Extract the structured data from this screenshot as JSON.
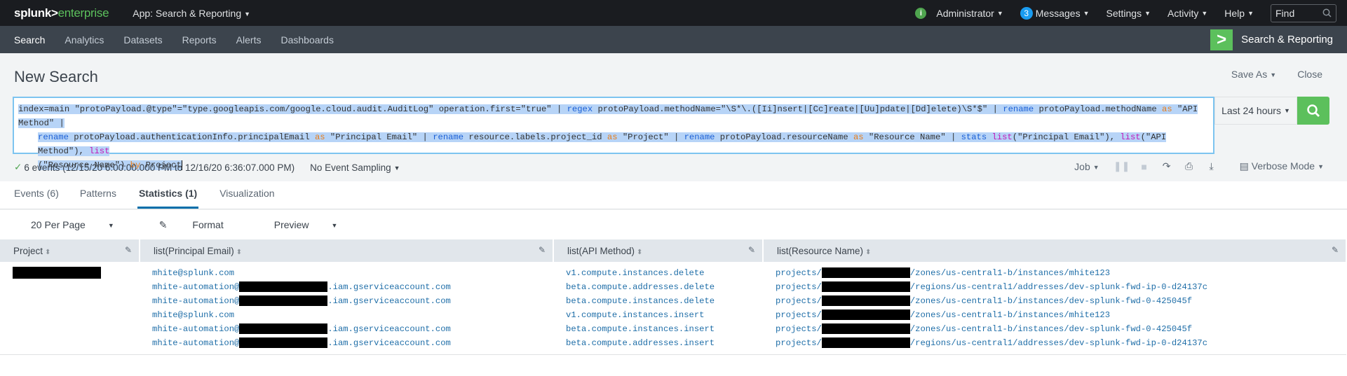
{
  "topbar": {
    "logo_primary": "splunk>",
    "logo_secondary": "enterprise",
    "app_menu": "App: Search & Reporting",
    "user_menu": "Administrator",
    "messages_count": "3",
    "messages_label": "Messages",
    "settings_label": "Settings",
    "activity_label": "Activity",
    "help_label": "Help",
    "find_placeholder": "Find"
  },
  "navbar": {
    "items": [
      "Search",
      "Analytics",
      "Datasets",
      "Reports",
      "Alerts",
      "Dashboards"
    ],
    "active": "Search",
    "app_title": "Search & Reporting"
  },
  "header": {
    "title": "New Search",
    "save_as": "Save As",
    "close": "Close"
  },
  "search": {
    "query_line1_a": "index=main \"protoPayload.@type\"=\"type.googleapis.com/google.cloud.audit.AuditLog\" operation.first=\"true\" | ",
    "kw_regex": "regex",
    "query_line1_b": " protoPayload.methodName=\"\\S*\\.([Ii]nsert|[Cc]reate|[Uu]pdate|[Dd]elete)\\S*$\" | ",
    "kw_rename1": "rename",
    "query_line1_c": " protoPayload.methodName ",
    "kw_as1": "as",
    "query_line1_d": " \"API Method\" |",
    "kw_rename2": "rename",
    "query_line2_a": " protoPayload.authenticationInfo.principalEmail ",
    "kw_as2": "as",
    "query_line2_b": " \"Principal Email\" | ",
    "kw_rename3": "rename",
    "query_line2_c": " resource.labels.project_id ",
    "kw_as3": "as",
    "query_line2_d": " \"Project\" | ",
    "kw_rename4": "rename",
    "query_line2_e": " protoPayload.resourceName ",
    "kw_as4": "as",
    "query_line2_f": " \"Resource Name\" | ",
    "kw_stats": "stats",
    "query_line2_g": " ",
    "fn_list1": "list",
    "query_line2_h": "(\"Principal Email\"), ",
    "fn_list2": "list",
    "query_line2_i": "(\"API Method\"), ",
    "fn_list3": "list",
    "query_line3_a": "(\"Resource Name\") ",
    "kw_by": "by",
    "query_line3_b": " Project",
    "time_range": "Last 24 hours"
  },
  "status": {
    "summary": "6 events (12/15/20 6:00:00.000 PM to 12/16/20 6:36:07.000 PM)",
    "sampling": "No Event Sampling",
    "job_label": "Job",
    "mode": "Verbose Mode"
  },
  "tabs": [
    {
      "label": "Events (6)",
      "active": false
    },
    {
      "label": "Patterns",
      "active": false
    },
    {
      "label": "Statistics (1)",
      "active": true
    },
    {
      "label": "Visualization",
      "active": false
    }
  ],
  "result_tools": {
    "per_page": "20 Per Page",
    "format": "Format",
    "preview": "Preview"
  },
  "table": {
    "columns": [
      "Project",
      "list(Principal Email)",
      "list(API Method)",
      "list(Resource Name)"
    ],
    "rows": [
      {
        "project": "[redacted]",
        "emails": [
          {
            "prefix": "mhite@splunk.com",
            "redacted": false,
            "suffix": ""
          },
          {
            "prefix": "mhite-automation@",
            "redacted": true,
            "suffix": ".iam.gserviceaccount.com"
          },
          {
            "prefix": "mhite-automation@",
            "redacted": true,
            "suffix": ".iam.gserviceaccount.com"
          },
          {
            "prefix": "mhite@splunk.com",
            "redacted": false,
            "suffix": ""
          },
          {
            "prefix": "mhite-automation@",
            "redacted": true,
            "suffix": ".iam.gserviceaccount.com"
          },
          {
            "prefix": "mhite-automation@",
            "redacted": true,
            "suffix": ".iam.gserviceaccount.com"
          }
        ],
        "methods": [
          "v1.compute.instances.delete",
          "beta.compute.addresses.delete",
          "beta.compute.instances.delete",
          "v1.compute.instances.insert",
          "beta.compute.instances.insert",
          "beta.compute.addresses.insert"
        ],
        "resources": [
          {
            "prefix": "projects/",
            "suffix": "/zones/us-central1-b/instances/mhite123"
          },
          {
            "prefix": "projects/",
            "suffix": "/regions/us-central1/addresses/dev-splunk-fwd-ip-0-d24137c"
          },
          {
            "prefix": "projects/",
            "suffix": "/zones/us-central1-b/instances/dev-splunk-fwd-0-425045f"
          },
          {
            "prefix": "projects/",
            "suffix": "/zones/us-central1-b/instances/mhite123"
          },
          {
            "prefix": "projects/",
            "suffix": "/zones/us-central1-b/instances/dev-splunk-fwd-0-425045f"
          },
          {
            "prefix": "projects/",
            "suffix": "/regions/us-central1/addresses/dev-splunk-fwd-ip-0-d24137c"
          }
        ]
      }
    ]
  },
  "colors": {
    "brand_green": "#5cc05c",
    "topbar_bg": "#1a1c20",
    "navbar_bg": "#3c444d",
    "link_blue": "#1f6ea8",
    "active_tab": "#006eaa",
    "search_border": "#7dc4f0",
    "selection": "#b7d4f7"
  }
}
